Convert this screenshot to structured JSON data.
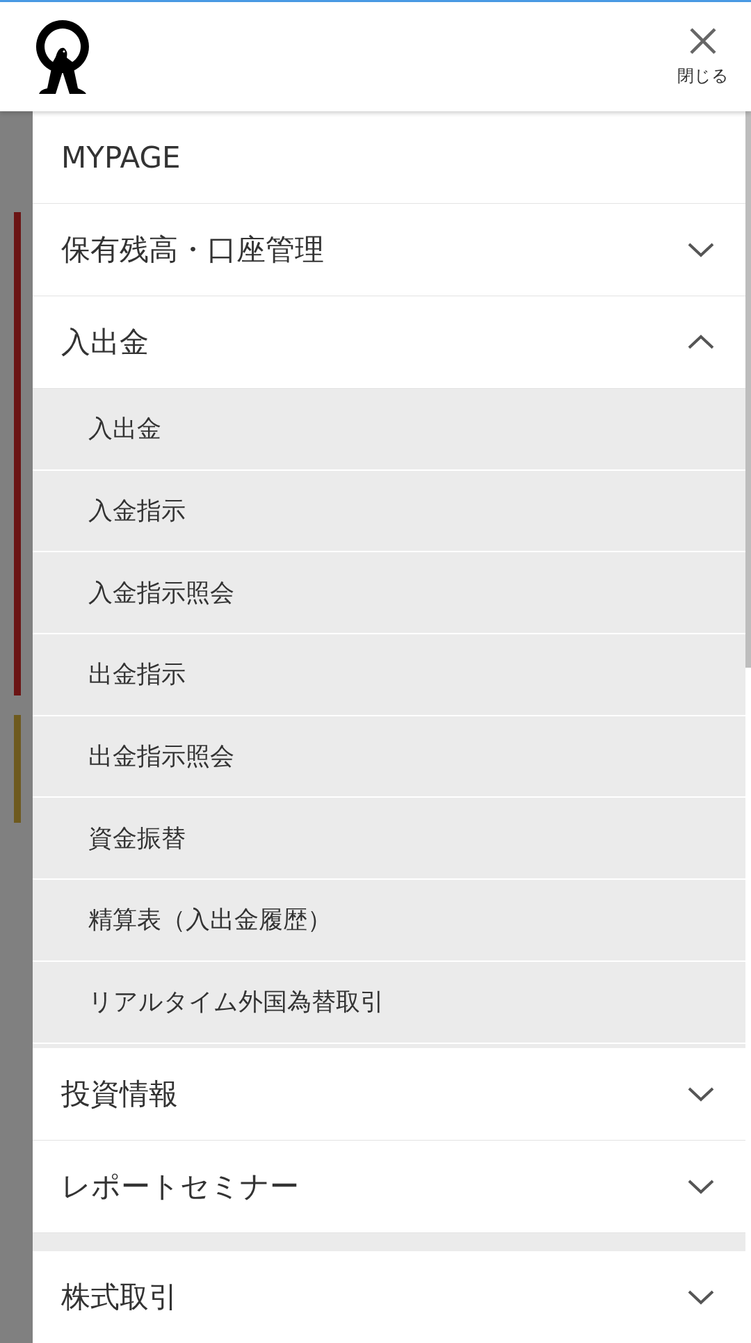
{
  "header": {
    "close_label": "閉じる"
  },
  "menu": [
    {
      "kind": "link",
      "label": "MYPAGE"
    },
    {
      "kind": "group",
      "label": "保有残高・口座管理",
      "expanded": false
    },
    {
      "kind": "group",
      "label": "入出金",
      "expanded": true,
      "children": [
        {
          "label": "入出金"
        },
        {
          "label": "入金指示"
        },
        {
          "label": "入金指示照会"
        },
        {
          "label": "出金指示"
        },
        {
          "label": "出金指示照会"
        },
        {
          "label": "資金振替"
        },
        {
          "label": "精算表（入出金履歴）"
        },
        {
          "label": "リアルタイム外国為替取引"
        }
      ]
    },
    {
      "kind": "group",
      "label": "投資情報",
      "expanded": false
    },
    {
      "kind": "group",
      "label": "レポートセミナー",
      "expanded": false
    },
    {
      "kind": "group",
      "label": "株式取引",
      "expanded": false,
      "section_start": true
    }
  ]
}
